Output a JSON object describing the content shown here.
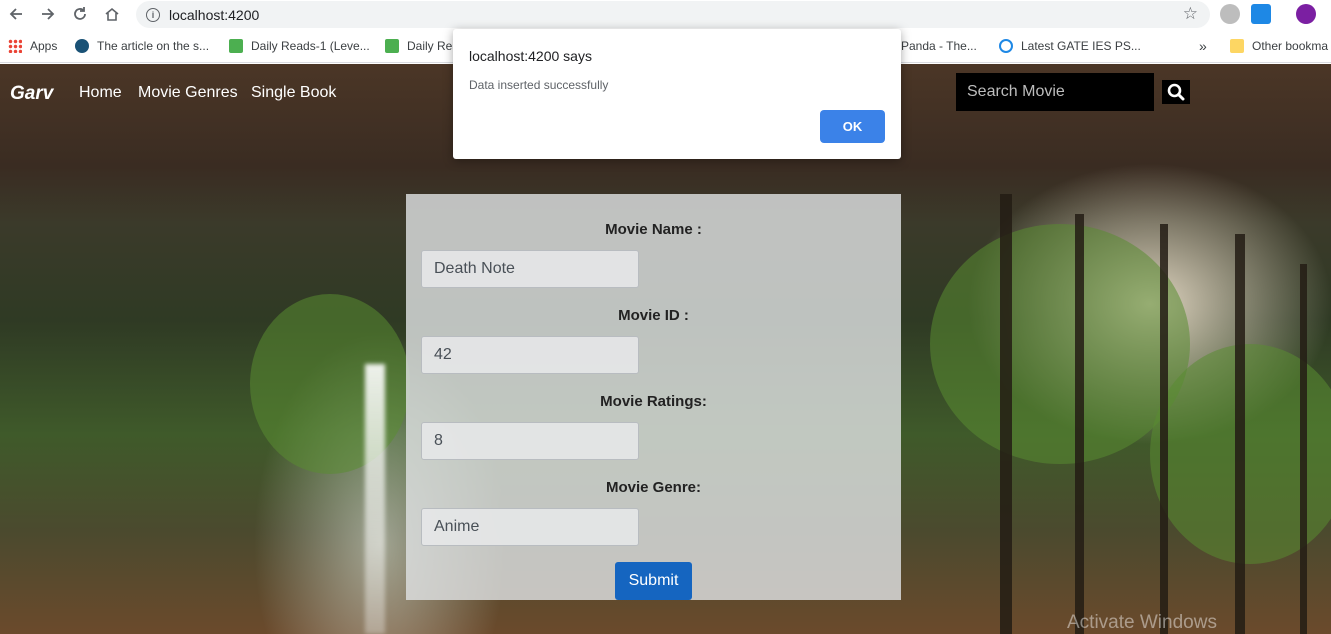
{
  "browser": {
    "url": "localhost:4200",
    "bookmarks": [
      "Apps",
      "The article on the s...",
      "Daily Reads-1 (Leve...",
      "Daily Rea",
      "Panda - The...",
      "Latest GATE IES PS...",
      "Other bookma"
    ],
    "overflow_label": "»"
  },
  "dialog": {
    "title": "localhost:4200 says",
    "message": "Data inserted successfully",
    "ok_label": "OK"
  },
  "navbar": {
    "brand": "Garv",
    "links": [
      "Home",
      "Movie Genres",
      "Single Book"
    ],
    "search_placeholder": "Search Movie"
  },
  "form": {
    "fields": [
      {
        "label": "Movie Name :",
        "value": "Death Note"
      },
      {
        "label": "Movie ID :",
        "value": "42"
      },
      {
        "label": "Movie Ratings:",
        "value": "8"
      },
      {
        "label": "Movie Genre:",
        "value": "Anime"
      }
    ],
    "submit_label": "Submit"
  },
  "watermark": "Activate Windows",
  "colors": {
    "accent": "#1565c0",
    "dialog_button": "#3b82e8"
  }
}
